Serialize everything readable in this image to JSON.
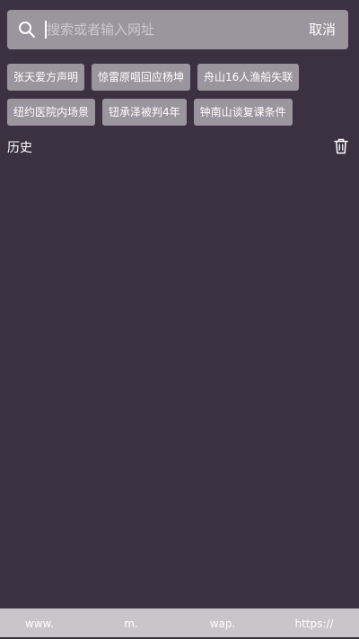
{
  "search": {
    "placeholder": "搜索或者输入网址",
    "cancel_label": "取消"
  },
  "hot_tags": {
    "row1": [
      "张天爱方声明",
      "惊雷原唱回应杨坤",
      "舟山16人渔船失联"
    ],
    "row2": [
      "纽约医院内场景",
      "钮承泽被判4年",
      "钟南山谈复课条件"
    ]
  },
  "history": {
    "title": "历史"
  },
  "url_prefixes": [
    "www.",
    "m.",
    "wap.",
    "https://"
  ],
  "colors": {
    "background": "#3c3141",
    "search_bar": "#9b959e",
    "tag": "#9b959e",
    "bottom_bar": "#c9c6cb"
  },
  "icons": {
    "search": "search-icon",
    "trash": "trash-icon"
  }
}
